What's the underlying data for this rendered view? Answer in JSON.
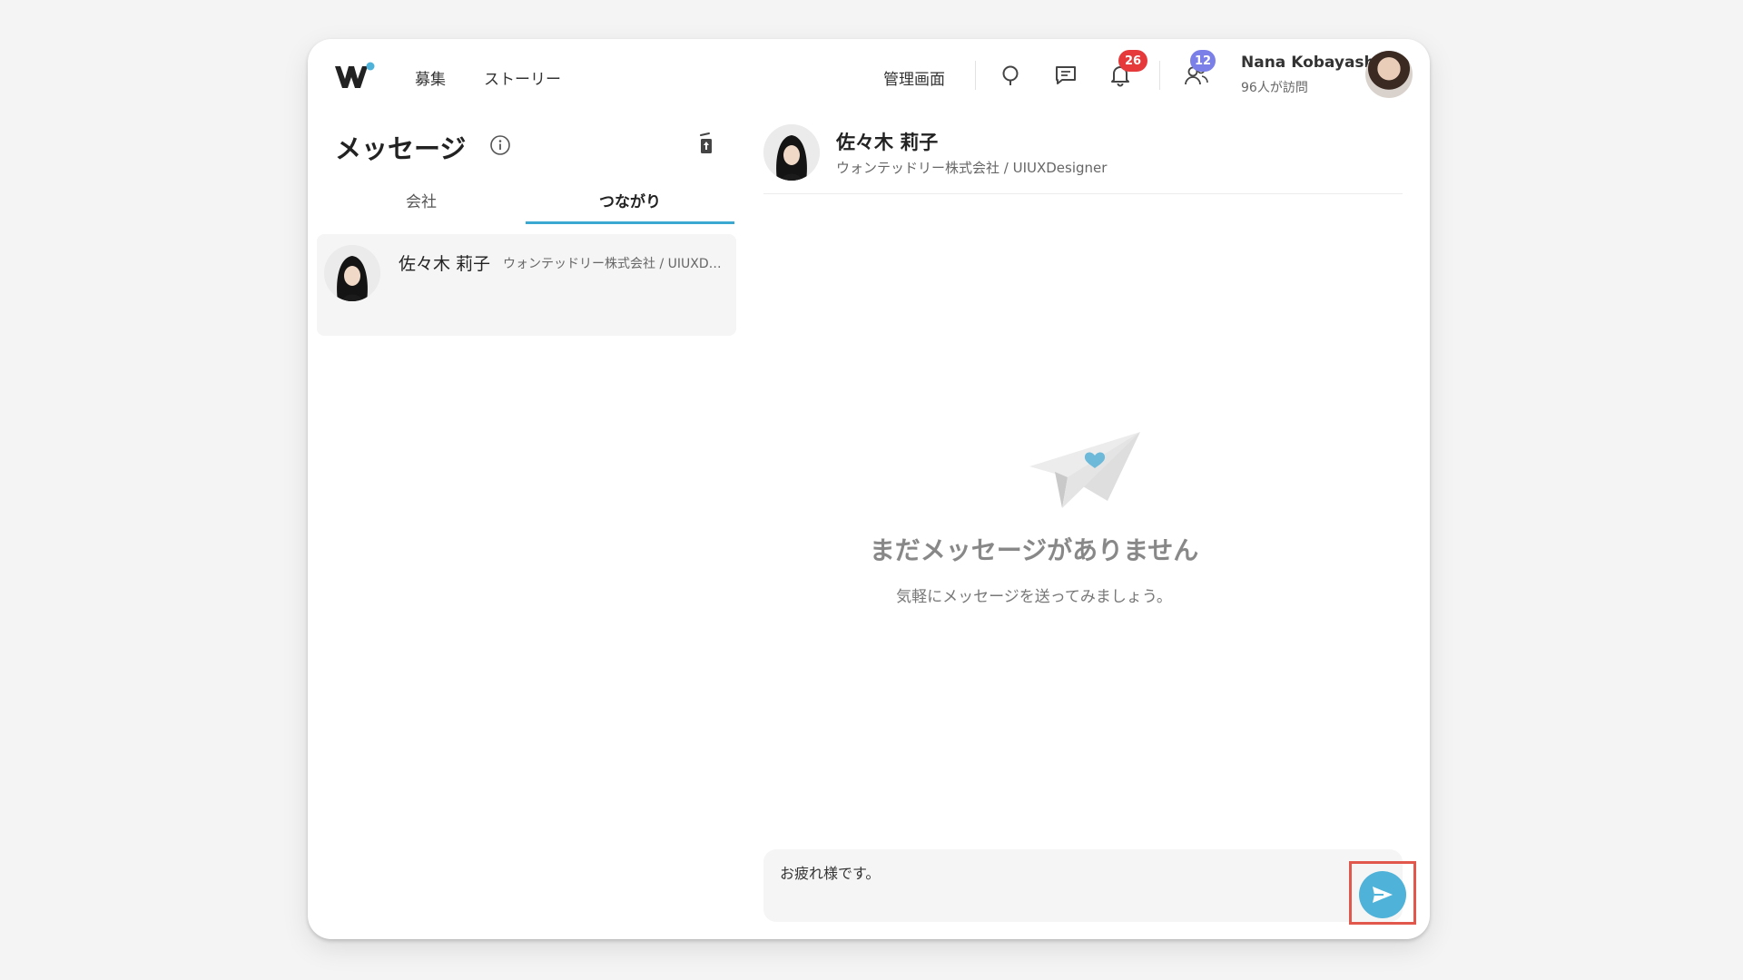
{
  "header": {
    "nav": {
      "recruit": "募集",
      "stories": "ストーリー"
    },
    "admin_label": "管理画面",
    "notifications_count": "26",
    "visitors_count": "12",
    "user": {
      "name": "Nana Kobayashi",
      "visits": "96人が訪問"
    }
  },
  "sidebar": {
    "title": "メッセージ",
    "tabs": [
      {
        "label": "会社",
        "active": false
      },
      {
        "label": "つながり",
        "active": true
      }
    ],
    "conversations": [
      {
        "name": "佐々木 莉子",
        "company": "ウォンテッドリー株式会社 / UIUXDesigner"
      }
    ]
  },
  "chat": {
    "contact_name": "佐々木 莉子",
    "contact_subtitle": "ウォンテッドリー株式会社 / UIUXDesigner",
    "empty_title": "まだメッセージがありません",
    "empty_subtitle": "気軽にメッセージを送ってみましょう。",
    "composer_value": "お疲れ様です。"
  },
  "colors": {
    "accent": "#3aa8d0",
    "send": "#4fb2d8",
    "badge_red": "#e5393b",
    "badge_purple": "#7b7fe8",
    "highlight": "#e1574c"
  },
  "icons": [
    "logo-icon",
    "search-icon",
    "message-icon",
    "bell-icon",
    "visitors-icon",
    "info-icon",
    "trash-icon",
    "paper-plane-icon",
    "send-icon"
  ]
}
